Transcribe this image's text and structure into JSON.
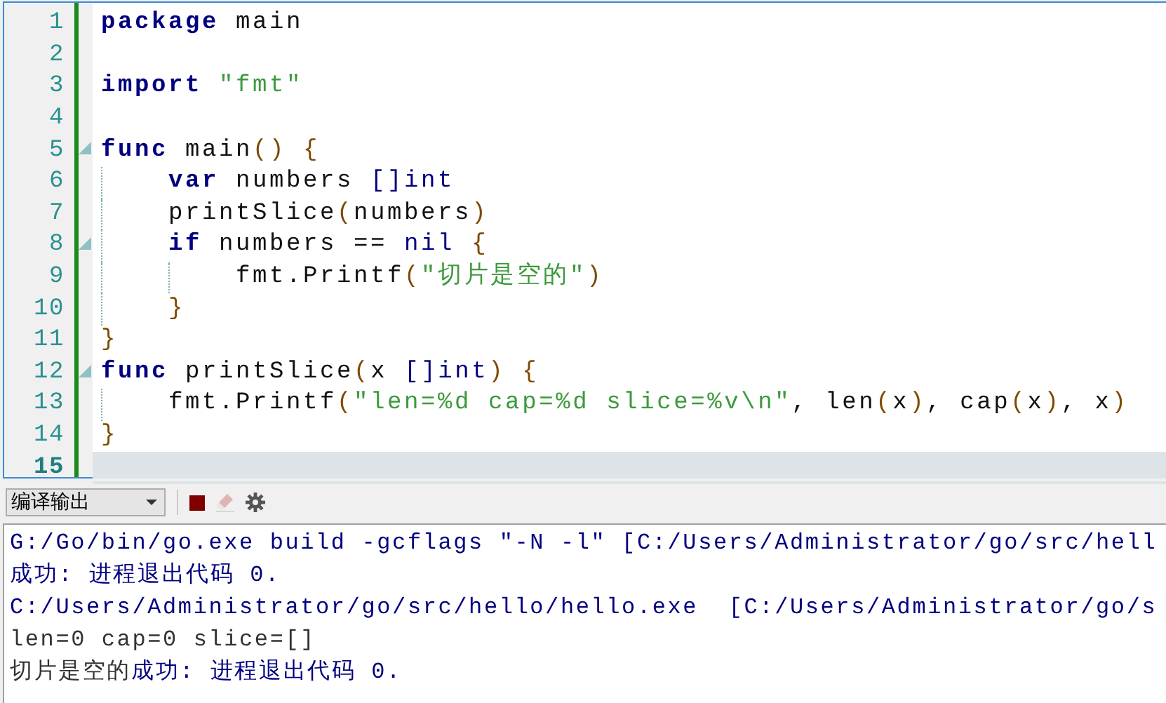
{
  "editor": {
    "lines": [
      {
        "number": "1",
        "fold": false,
        "current": false,
        "tokens": [
          {
            "t": "package",
            "kind": "kw"
          },
          {
            "t": " main",
            "kind": "id"
          }
        ]
      },
      {
        "number": "2",
        "fold": false,
        "current": false
      },
      {
        "number": "3",
        "fold": false,
        "current": false,
        "tokens": [
          {
            "t": "import",
            "kind": "kw"
          },
          {
            "t": " \"fmt\"",
            "kind": "str"
          }
        ]
      },
      {
        "number": "4",
        "fold": false,
        "current": false
      },
      {
        "number": "5",
        "fold": true,
        "current": false,
        "tokens": [
          {
            "t": "func",
            "kind": "kw"
          },
          {
            "t": " main",
            "kind": "id"
          },
          {
            "t": "() {",
            "kind": "punct"
          }
        ],
        "children": [
          {
            "number": "6",
            "fold": false,
            "current": false,
            "tokens": [
              {
                "t": "var",
                "kind": "kw"
              },
              {
                "t": " numbers ",
                "kind": "id"
              },
              {
                "t": "[]int",
                "kind": "type"
              }
            ]
          },
          {
            "number": "7",
            "fold": false,
            "current": false,
            "tokens": [
              {
                "t": "printSlice",
                "kind": "id"
              },
              {
                "t": "(",
                "kind": "punct"
              },
              {
                "t": "numbers",
                "kind": "id"
              },
              {
                "t": ")",
                "kind": "punct"
              }
            ]
          },
          {
            "number": "8",
            "fold": true,
            "current": false,
            "tokens": [
              {
                "t": "if",
                "kind": "kw"
              },
              {
                "t": " numbers == ",
                "kind": "id"
              },
              {
                "t": "nil",
                "kind": "type"
              },
              {
                "t": " {",
                "kind": "punct"
              }
            ],
            "children": [
              {
                "number": "9",
                "fold": false,
                "current": false,
                "tokens": [
                  {
                    "t": "fmt.Printf",
                    "kind": "id"
                  },
                  {
                    "t": "(",
                    "kind": "punct"
                  },
                  {
                    "t": "\"切片是空的\"",
                    "kind": "str"
                  },
                  {
                    "t": ")",
                    "kind": "punct"
                  }
                ]
              }
            ]
          },
          {
            "number": "10",
            "fold": false,
            "current": false,
            "tokens": [
              {
                "t": "}",
                "kind": "punct"
              }
            ]
          }
        ]
      },
      {
        "number": "11",
        "fold": false,
        "current": false,
        "tokens": [
          {
            "t": "}",
            "kind": "punct"
          }
        ]
      },
      {
        "number": "12",
        "fold": true,
        "current": false,
        "tokens": [
          {
            "t": "func",
            "kind": "kw"
          },
          {
            "t": " printSlice",
            "kind": "id"
          },
          {
            "t": "(",
            "kind": "punct"
          },
          {
            "t": "x ",
            "kind": "id"
          },
          {
            "t": "[]int",
            "kind": "type"
          },
          {
            "t": ") {",
            "kind": "punct"
          }
        ],
        "children": [
          {
            "number": "13",
            "fold": false,
            "current": false,
            "tokens": [
              {
                "t": "fmt.Printf",
                "kind": "id"
              },
              {
                "t": "(",
                "kind": "punct"
              },
              {
                "t": "\"len=%d cap=%d slice=%v\\n\"",
                "kind": "str"
              },
              {
                "t": ", len",
                "kind": "id"
              },
              {
                "t": "(",
                "kind": "punct"
              },
              {
                "t": "x",
                "kind": "id"
              },
              {
                "t": ")",
                "kind": "punct"
              },
              {
                "t": ", cap",
                "kind": "id"
              },
              {
                "t": "(",
                "kind": "punct"
              },
              {
                "t": "x",
                "kind": "id"
              },
              {
                "t": ")",
                "kind": "punct"
              },
              {
                "t": ", x",
                "kind": "id"
              },
              {
                "t": ")",
                "kind": "punct"
              }
            ]
          }
        ]
      },
      {
        "number": "14",
        "fold": false,
        "current": false,
        "tokens": [
          {
            "t": "}",
            "kind": "punct"
          }
        ]
      },
      {
        "number": "15",
        "fold": false,
        "current": true
      }
    ]
  },
  "output_toolbar": {
    "dropdown": {
      "value": "编译输出"
    },
    "buttons": [
      {
        "kind": "stop",
        "disabled": false
      },
      {
        "kind": "clear",
        "disabled": true
      },
      {
        "kind": "settings",
        "disabled": false
      }
    ]
  },
  "output": {
    "lines": [
      {
        "segments": [
          {
            "t": "G:/Go/bin/go.exe build -gcflags ″-N -l″ [C:/Users/Administrator/go/src/hell",
            "kind": "info"
          }
        ]
      },
      {
        "segments": [
          {
            "t": "成功: 进程退出代码 0.",
            "kind": "info"
          }
        ]
      },
      {
        "segments": [
          {
            "t": "C:/Users/Administrator/go/src/hello/hello.exe  [C:/Users/Administrator/go/s",
            "kind": "info"
          }
        ]
      },
      {
        "segments": [
          {
            "t": "len=0 cap=0 slice=[]",
            "kind": "stdout"
          }
        ]
      },
      {
        "segments": [
          {
            "t": "切片是空的",
            "kind": "stdout"
          },
          {
            "t": "成功: 进程退出代码 0.",
            "kind": "info"
          }
        ]
      }
    ]
  }
}
